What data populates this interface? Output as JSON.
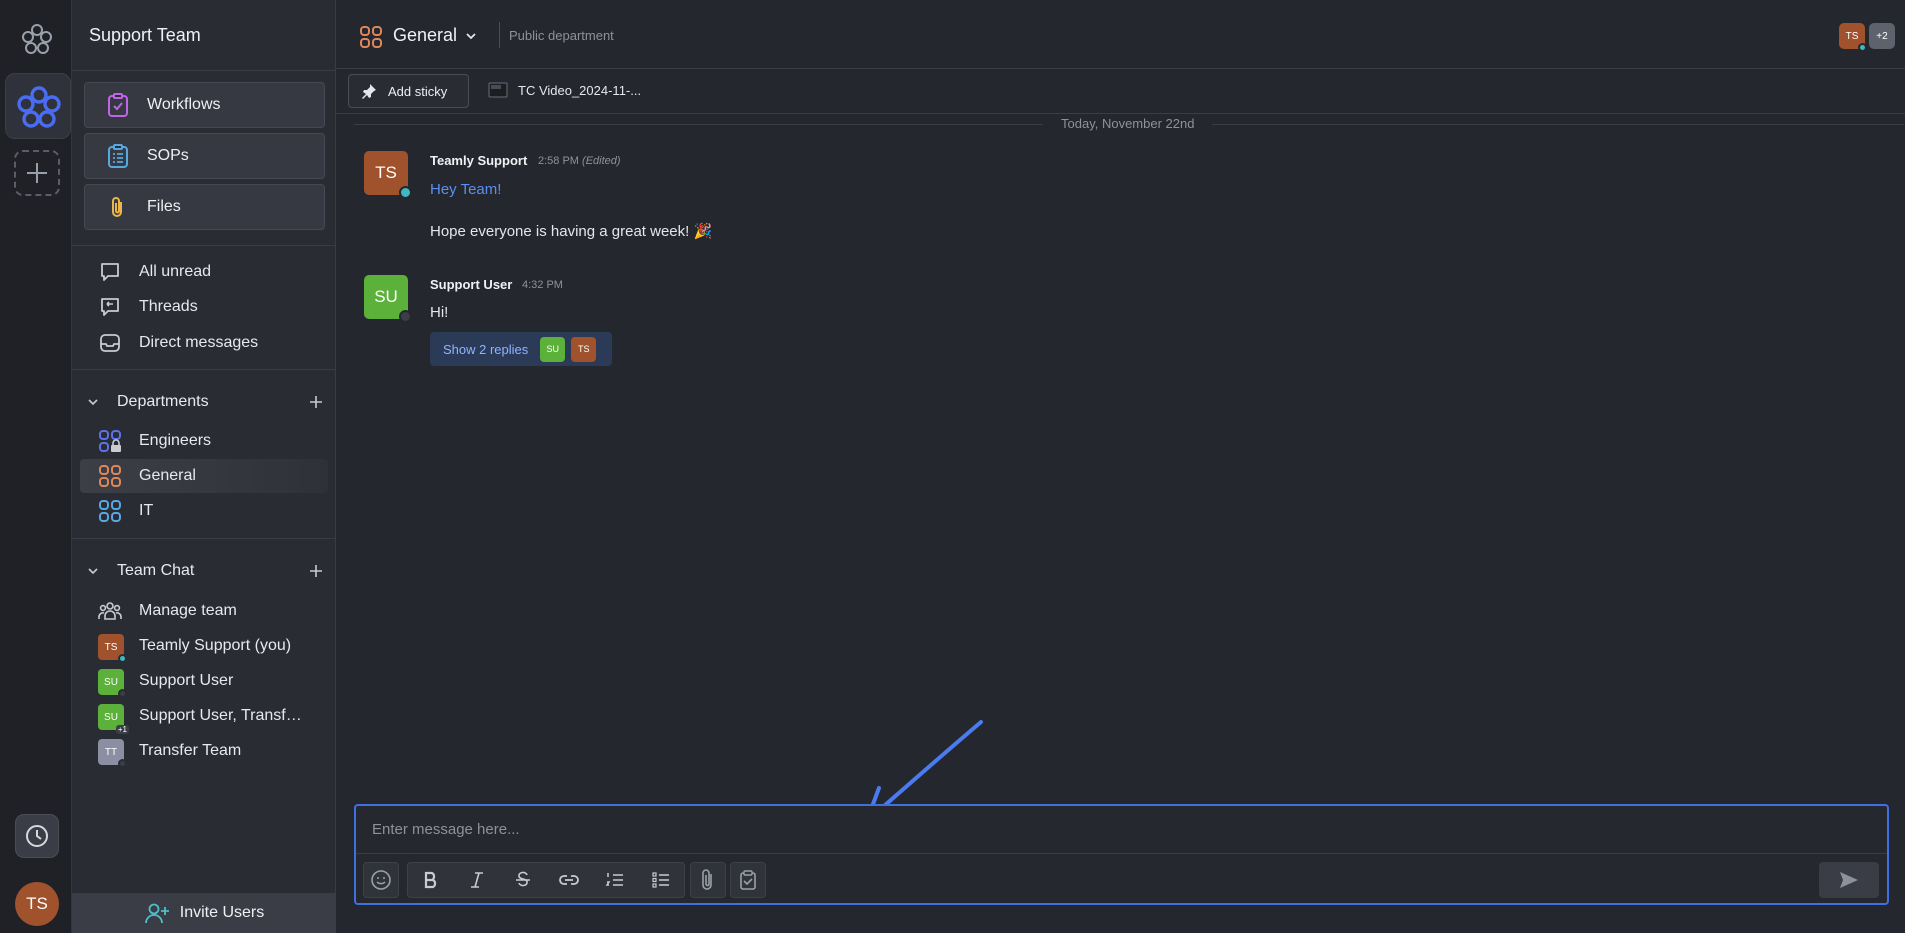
{
  "rail": {
    "user_initials": "TS"
  },
  "sidebar": {
    "team_name": "Support Team",
    "top_buttons": [
      {
        "label": "Workflows",
        "icon": "workflow-clipboard-icon"
      },
      {
        "label": "SOPs",
        "icon": "sop-list-icon"
      },
      {
        "label": "Files",
        "icon": "paperclip-icon"
      }
    ],
    "nav": [
      {
        "label": "All unread",
        "icon": "chat-bubble-icon"
      },
      {
        "label": "Threads",
        "icon": "threads-icon"
      },
      {
        "label": "Direct messages",
        "icon": "inbox-icon"
      }
    ],
    "departments": {
      "title": "Departments",
      "items": [
        {
          "label": "Engineers",
          "icon": "locked-department-icon",
          "color": "#5b73e8"
        },
        {
          "label": "General",
          "icon": "department-icon",
          "color": "#e0875a",
          "active": true
        },
        {
          "label": "IT",
          "icon": "department-icon",
          "color": "#57a8e0"
        }
      ]
    },
    "team_chat": {
      "title": "Team Chat",
      "items": [
        {
          "label": "Manage team",
          "icon": "team-icon"
        },
        {
          "label": "Teamly Support (you)",
          "initials": "TS",
          "color": "#a0522d",
          "status": "online"
        },
        {
          "label": "Support User",
          "initials": "SU",
          "color": "#5bb13a",
          "status": "offline"
        },
        {
          "label": "Support User, Transfer ...",
          "initials": "SU",
          "badge": "+1",
          "color": "#5bb13a"
        },
        {
          "label": "Transfer Team",
          "initials": "TT",
          "color": "#8c8fa3",
          "status": "offline"
        }
      ]
    },
    "invite_label": "Invite Users"
  },
  "header": {
    "title": "General",
    "subtitle": "Public department",
    "members": [
      "TS",
      "+2"
    ]
  },
  "toolbar": {
    "add_sticky": "Add sticky",
    "file_tab": "TC Video_2024-11-..."
  },
  "date_separator": "Today, November 22nd",
  "messages": [
    {
      "initials": "TS",
      "name": "Teamly Support",
      "time": "2:58 PM",
      "edited": "(Edited)",
      "lines": [
        "Hey Team!",
        "Hope everyone is having a great week! 🎉"
      ],
      "color": "#a0522d"
    },
    {
      "initials": "SU",
      "name": "Support User",
      "time": "4:32 PM",
      "lines": [
        "Hi!"
      ],
      "replies_label": "Show 2 replies",
      "reply_avatars": [
        "SU",
        "TS"
      ],
      "color": "#5bb13a"
    }
  ],
  "composer": {
    "placeholder": "Enter message here...",
    "tools": [
      "emoji-icon",
      "bold-icon",
      "italic-icon",
      "strikethrough-icon",
      "link-icon",
      "ordered-list-icon",
      "checklist-icon",
      "attach-icon",
      "task-icon",
      "send-icon"
    ]
  },
  "colors": {
    "accent": "#3f6fe0",
    "online": "#3fb8c4"
  }
}
